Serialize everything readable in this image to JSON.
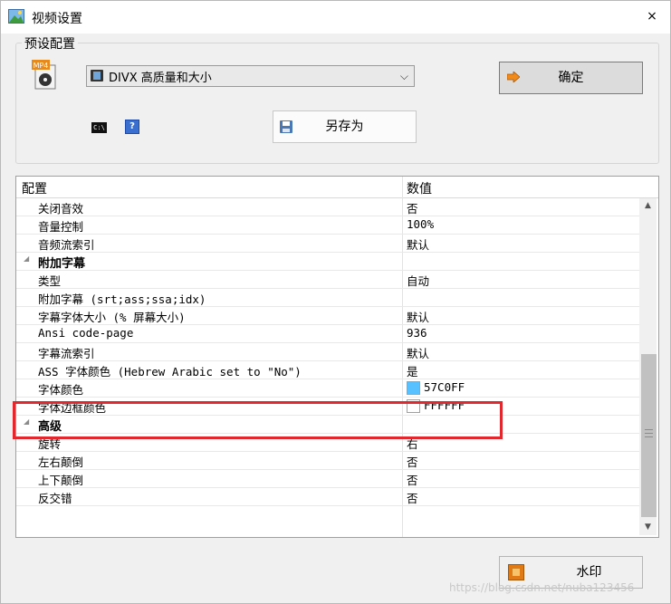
{
  "window": {
    "title": "视频设置",
    "close_glyph": "×"
  },
  "preset": {
    "group_title": "预设配置",
    "selected_profile": "DIVX 高质量和大小",
    "dropdown_glyph": "⌵",
    "ok_label": "确定",
    "save_as_label": "另存为",
    "cmd_icon_text": "C:\\",
    "help_icon_text": "?",
    "profile_icon_badge": "MP4"
  },
  "grid": {
    "header_key": "配置",
    "header_value": "数值",
    "rows": [
      {
        "k": "关闭音效",
        "v": "否"
      },
      {
        "k": "音量控制",
        "v": "100%"
      },
      {
        "k": "音频流索引",
        "v": "默认"
      },
      {
        "k": "附加字幕",
        "v": ""
      },
      {
        "k": "类型",
        "v": "自动"
      },
      {
        "k": "附加字幕 (srt;ass;ssa;idx)",
        "v": ""
      },
      {
        "k": "字幕字体大小 (% 屏幕大小)",
        "v": "默认"
      },
      {
        "k": "Ansi code-page",
        "v": "936"
      },
      {
        "k": "字幕流索引",
        "v": "默认"
      },
      {
        "k": "ASS 字体颜色 (Hebrew Arabic set to \"No\")",
        "v": "是"
      },
      {
        "k": "字体颜色",
        "v": "57C0FF"
      },
      {
        "k": "字体边框颜色",
        "v": "FFFFFF"
      },
      {
        "k": "高级",
        "v": ""
      },
      {
        "k": "旋转",
        "v": "右"
      },
      {
        "k": "左右颠倒",
        "v": "否"
      },
      {
        "k": "上下颠倒",
        "v": "否"
      },
      {
        "k": "反交错",
        "v": "否"
      }
    ],
    "font_color_swatch": "#57C0FF",
    "border_color_swatch": "#FFFFFF"
  },
  "footer": {
    "watermark_label": "水印"
  },
  "overlay": {
    "site_watermark": "https://blog.csdn.net/nuba123456"
  },
  "colors": {
    "highlight": "#e0282e"
  }
}
